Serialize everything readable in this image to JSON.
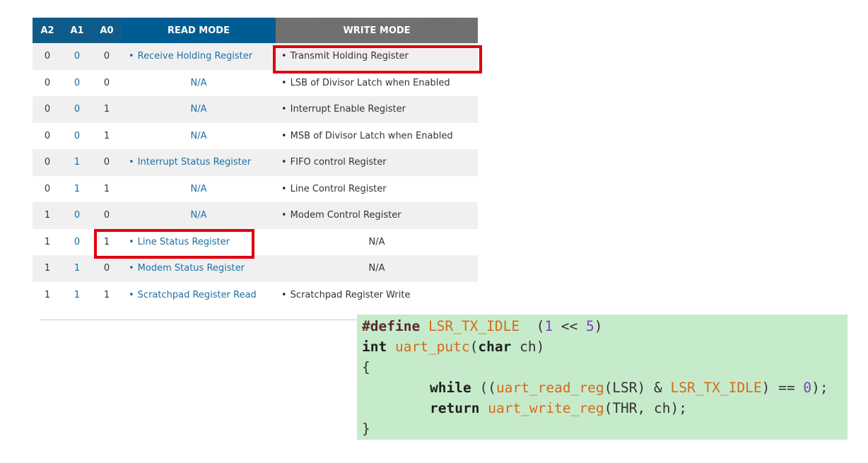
{
  "table": {
    "headers": {
      "a2": "A2",
      "a1": "A1",
      "a0": "A0",
      "read": "READ MODE",
      "write": "WRITE MODE"
    },
    "rows": [
      {
        "a2": "0",
        "a1": "0",
        "a0": "0",
        "read": "Receive Holding Register",
        "write": "Transmit Holding Register"
      },
      {
        "a2": "0",
        "a1": "0",
        "a0": "0",
        "read": "N/A",
        "write": "LSB of Divisor Latch when Enabled"
      },
      {
        "a2": "0",
        "a1": "0",
        "a0": "1",
        "read": "N/A",
        "write": "Interrupt Enable Register"
      },
      {
        "a2": "0",
        "a1": "0",
        "a0": "1",
        "read": "N/A",
        "write": "MSB of Divisor Latch when Enabled"
      },
      {
        "a2": "0",
        "a1": "1",
        "a0": "0",
        "read": "Interrupt Status Register",
        "write": "FIFO control Register"
      },
      {
        "a2": "0",
        "a1": "1",
        "a0": "1",
        "read": "N/A",
        "write": "Line Control Register"
      },
      {
        "a2": "1",
        "a1": "0",
        "a0": "0",
        "read": "N/A",
        "write": "Modem Control Register"
      },
      {
        "a2": "1",
        "a1": "0",
        "a0": "1",
        "read": "Line Status Register",
        "write": "N/A"
      },
      {
        "a2": "1",
        "a1": "1",
        "a0": "0",
        "read": "Modem Status Register",
        "write": "N/A"
      },
      {
        "a2": "1",
        "a1": "1",
        "a0": "1",
        "read": "Scratchpad Register Read",
        "write": "Scratchpad Register Write"
      }
    ]
  },
  "code": {
    "l1_kw": "#define",
    "l1_name": "LSR_TX_IDLE",
    "l1_open": "(",
    "l1_n1": "1",
    "l1_op": " << ",
    "l1_n2": "5",
    "l1_close": ")",
    "l2_type": "int",
    "l2_fn": "uart_putc",
    "l2_open": "(",
    "l2_ptype": "char",
    "l2_param": " ch)",
    "l3": "{",
    "l4_kw": "while",
    "l4_a": " ((",
    "l4_fn": "uart_read_reg",
    "l4_b": "(LSR) & ",
    "l4_const": "LSR_TX_IDLE",
    "l4_c": ") == ",
    "l4_num": "0",
    "l4_d": ");",
    "l5_kw": "return",
    "l5_sp": " ",
    "l5_fn": "uart_write_reg",
    "l5_args": "(THR, ch);",
    "l6": "}"
  },
  "colors": {
    "highlight": "#e0000e",
    "code_bg": "#c6ebcb",
    "header_blue": "#005d93",
    "header_gray": "#6d6d6d"
  }
}
